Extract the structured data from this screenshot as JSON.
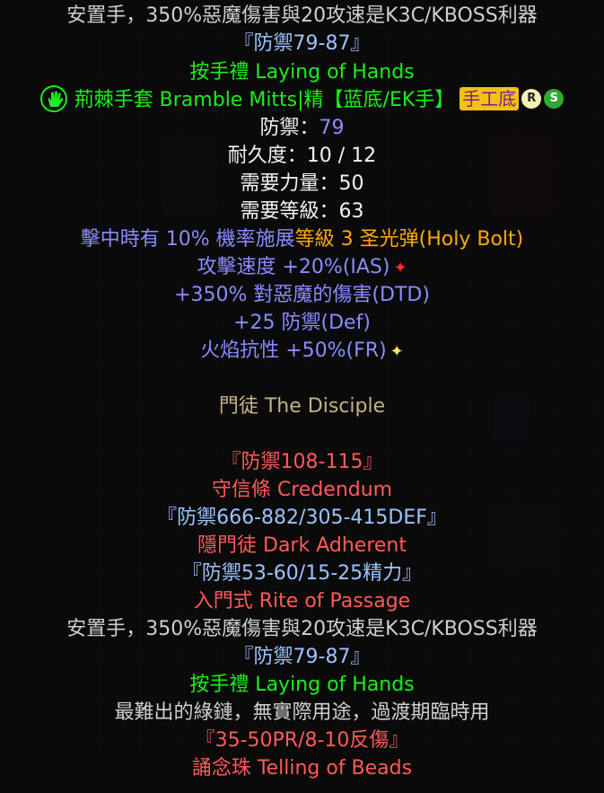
{
  "tooltip": {
    "lines": [
      {
        "text": "安置手，350%惡魔傷害與20攻速是K3C/KBOSS利器",
        "color": "gray"
      },
      {
        "text": "『防禦79-87』",
        "color": "lblue"
      },
      {
        "text": "按手禮 Laying of Hands",
        "color": "green"
      },
      {
        "text": "荊棘手套 Bramble Mitts|精【蓝底/EK手】",
        "color": "green"
      },
      {
        "label": "防禦：",
        "value": "79"
      },
      {
        "text": "耐久度：10 / 12",
        "color": "white"
      },
      {
        "text": "需要力量：50",
        "color": "white"
      },
      {
        "text": "需要等級：63",
        "color": "white"
      },
      {
        "prefix": "擊中時有 10% 機率施展",
        "suffix": "等級 3 圣光弹(Holy Bolt)"
      },
      {
        "text": "攻擊速度 +20%(IAS)",
        "color": "blue"
      },
      {
        "text": "+350% 對惡魔的傷害(DTD)",
        "color": "blue"
      },
      {
        "text": "+25 防禦(Def)",
        "color": "blue"
      },
      {
        "text": "火焰抗性 +50%(FR)",
        "color": "blue"
      },
      {
        "text": "門徒 The Disciple",
        "color": "gold"
      },
      {
        "text": "『防禦108-115』",
        "color": "red"
      },
      {
        "text": "守信條 Credendum",
        "color": "red"
      },
      {
        "text": "『防禦666-882/305-415DEF』",
        "color": "lblue"
      },
      {
        "text": "隱門徒 Dark Adherent",
        "color": "red"
      },
      {
        "text": "『防禦53-60/15-25精力』",
        "color": "lblue"
      },
      {
        "text": "入門式 Rite of Passage",
        "color": "red"
      },
      {
        "text": "安置手，350%惡魔傷害與20攻速是K3C/KBOSS利器",
        "color": "gray"
      },
      {
        "text": "『防禦79-87』",
        "color": "lblue"
      },
      {
        "text": "按手禮 Laying of Hands",
        "color": "green"
      },
      {
        "text": "最難出的綠鏈，無實際用途，過渡期臨時用",
        "color": "gray"
      },
      {
        "text": "『35-50PR/8-10反傷』",
        "color": "red"
      },
      {
        "text": "誦念珠 Telling of Beads",
        "color": "red"
      }
    ],
    "craft_tag": "手工底",
    "badge_r": "R",
    "badge_s": "S",
    "hand_icon": "green-hand-icon",
    "colors": {
      "green": "#19f019",
      "blue": "#8b8bff",
      "gold": "#c6b382",
      "red": "#ff5a5a",
      "gray": "#cfcfcf",
      "orange": "#ffa800",
      "craft_bg": "#f2c20f"
    }
  }
}
